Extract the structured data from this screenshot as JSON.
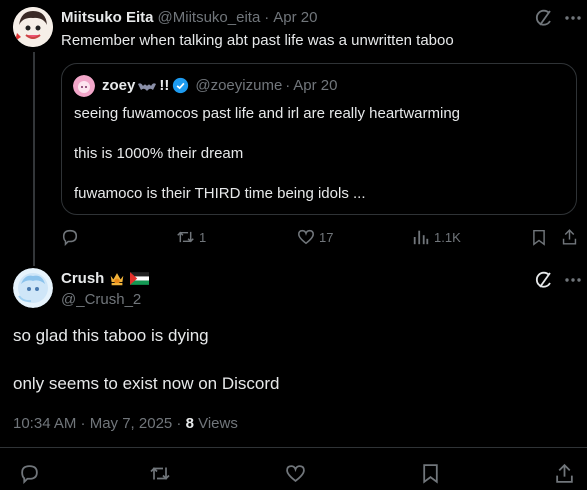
{
  "post1": {
    "author_name": "Miitsuko Eita",
    "author_handle": "@Miitsuko_eita",
    "separator": "·",
    "date": "Apr 20",
    "text": "Remember when talking abt past life was a unwritten taboo",
    "quote": {
      "author_name": "zoey",
      "name_suffix": "!!",
      "author_handle": "@zoeyizume",
      "date": "Apr 20",
      "lines": [
        "seeing fuwamocos past life and irl are really heartwarming",
        "this is 1000% their dream",
        "fuwamoco is their THIRD time being idols ..."
      ]
    },
    "actions": {
      "reposts": "1",
      "likes": "17",
      "views": "1.1K"
    }
  },
  "post2": {
    "author_name": "Crush",
    "author_handle": "@_Crush_2",
    "text_line1": "so glad this taboo is dying",
    "text_line2": "only seems to exist now on Discord",
    "timestamp": "10:34 AM · May 7, 2025 · ",
    "views_count": "8",
    "views_label": " Views"
  },
  "colors": {
    "background": "#000000",
    "text": "#e7e9ea",
    "muted": "#71767b",
    "border": "#2f3336",
    "verified": "#1d9bf0"
  },
  "icons": [
    "grok-icon",
    "more-icon",
    "reply-icon",
    "repost-icon",
    "like-icon",
    "views-icon",
    "bookmark-icon",
    "share-icon",
    "verified-badge-icon",
    "flag-icon"
  ]
}
